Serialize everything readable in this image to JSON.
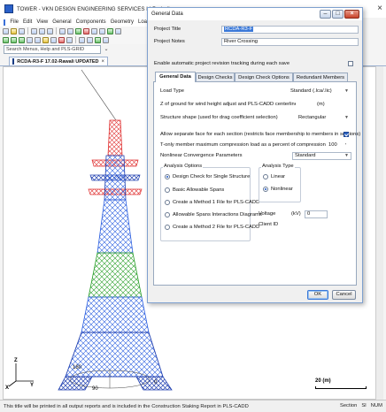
{
  "app": {
    "title": "TOWER - VKN DESIGN ENGINEERING SERVICES LLP - India - ...",
    "close_glyph": "×",
    "menu": [
      "File",
      "Edit",
      "View",
      "General",
      "Components",
      "Geometry",
      "Loa"
    ],
    "search_placeholder": "Search Menus, Help and PLS-GRID",
    "search_glyph": "⌄",
    "doc_tab": "RCDA-R3-F 17.02-Rawali UPDATED",
    "doc_tab_close": "×"
  },
  "canvas": {
    "axis_labels": {
      "z": "Z",
      "x": "X",
      "y": "Y"
    },
    "rotation_labels": [
      "180",
      "90",
      "0"
    ],
    "scale_label": "20 (m)"
  },
  "status": {
    "message": "This title will be printed in all output reports and is included in the Construction Staking Report in PLS-CADD",
    "section": "Section",
    "units": "SI",
    "num": "NUM"
  },
  "dialog": {
    "title": "General Data",
    "caption_min": "–",
    "caption_max": "□",
    "caption_close": "×",
    "project_title_label": "Project Title",
    "project_title_value": "RCDA-R3-F",
    "project_notes_label": "Project Notes",
    "project_notes_value": "River Crossing",
    "revision_tracking_label": "Enable automatic project revision tracking during each save",
    "tabs": [
      "General Data",
      "Design Checks",
      "Design Check Options",
      "Redundant Members"
    ],
    "general": {
      "load_type_label": "Load Type",
      "load_type_value": "Standard (.lca/.lic)",
      "z_ground_label": "Z of ground for wind height adjust and PLS-CADD centerline",
      "z_ground_unit": "(m)",
      "z_ground_value": "",
      "shape_label": "Structure shape (used for drag coefficient selection)",
      "shape_value": "Rectangular",
      "separate_face_label": "Allow separate face for each section (restricts face membership to members in sections)",
      "separate_face_checked": true,
      "tension_only_label": "T-only member maximum compression load as a percent of compression capacity",
      "tension_only_value": "100",
      "nonlinear_label": "Nonlinear Convergence Parameters",
      "nonlinear_value": "Standard",
      "analysis_options_title": "Analysis Options",
      "analysis_options": [
        "Design Check for Single Structure",
        "Basic Allowable Spans",
        "Create a Method 1 File for PLS-CADD",
        "Allowable Spans Interactions Diagrams",
        "Create a Method 2 File for PLS-CADD"
      ],
      "analysis_options_selected": 0,
      "analysis_type_title": "Analysis Type",
      "analysis_types": [
        "Linear",
        "Nonlinear"
      ],
      "analysis_type_selected": 1,
      "voltage_label": "Voltage",
      "voltage_unit": "(kV)",
      "voltage_value": "0",
      "client_id_label": "Client ID"
    },
    "ok_label": "OK",
    "cancel_label": "Cancel"
  },
  "colors": {
    "tower_top": "#e03030",
    "tower_upper": "#2b5fe0",
    "tower_middle": "#2ca02c",
    "tower_bottom": "#2b5fe0",
    "accent": "#3a78d8"
  }
}
